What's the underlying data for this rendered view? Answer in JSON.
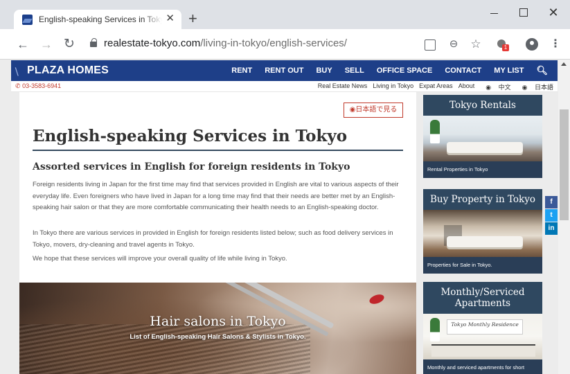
{
  "browser": {
    "tab_title": "English-speaking Services in Tokyo",
    "tab_close": "✕",
    "new_tab": "+",
    "url_host": "realestate-tokyo.com",
    "url_path": "/living-in-tokyo/english-services/",
    "ext_badge": "1",
    "icons": [
      "back-arrow-icon",
      "forward-arrow-icon",
      "reload-icon",
      "lock-icon",
      "translate-icon",
      "zoom-icon",
      "star-icon",
      "extension-icon",
      "account-icon",
      "menu-icon"
    ]
  },
  "site": {
    "logo": "PLAZA HOMES",
    "nav": [
      "RENT",
      "RENT OUT",
      "BUY",
      "SELL",
      "OFFICE SPACE",
      "CONTACT",
      "MY LIST"
    ],
    "phone": "03-3583-6941",
    "sublinks": [
      "Real Estate News",
      "Living in Tokyo",
      "Expat Areas",
      "About",
      "中文",
      "日本語"
    ],
    "accent_color": "#1e3f88"
  },
  "article": {
    "japanese_button": "日本語で見る",
    "title": "English-speaking Services in Tokyo",
    "subtitle": "Assorted services in English for foreign residents in Tokyo",
    "paragraphs": [
      "Foreign residents living in Japan for the first time may find that services provided in English are vital to  various aspects of their everyday life. Even foreigners who have lived in Japan for a long time may find that their needs are better met by an English-speaking hair salon or that they are more comfortable communicating their health needs to an English-speaking doctor.",
      "In Tokyo there are various services in provided in English for foreign residents listed below; such as food delivery services in Tokyo, movers, dry-cleaning and travel agents in Tokyo.",
      "We hope that these services will improve your overall quality of life while living in Tokyo."
    ],
    "hero_title": "Hair salons in Tokyo",
    "hero_subtitle": "List of English-speaking Hair Salons & Stylists in Tokyo."
  },
  "sidebar": {
    "cards": [
      {
        "title": "Tokyo Rentals",
        "caption": "Rental Properties in Tokyo"
      },
      {
        "title": "Buy Property in Tokyo",
        "caption": "Properties for Sale in Tokyo."
      },
      {
        "title": "Monthly/Serviced Apartments",
        "caption": "Monthly and serviced apartments for short",
        "image_label": "Tokyo Monthly Residence"
      }
    ]
  },
  "social": [
    "f",
    "t",
    "in"
  ]
}
